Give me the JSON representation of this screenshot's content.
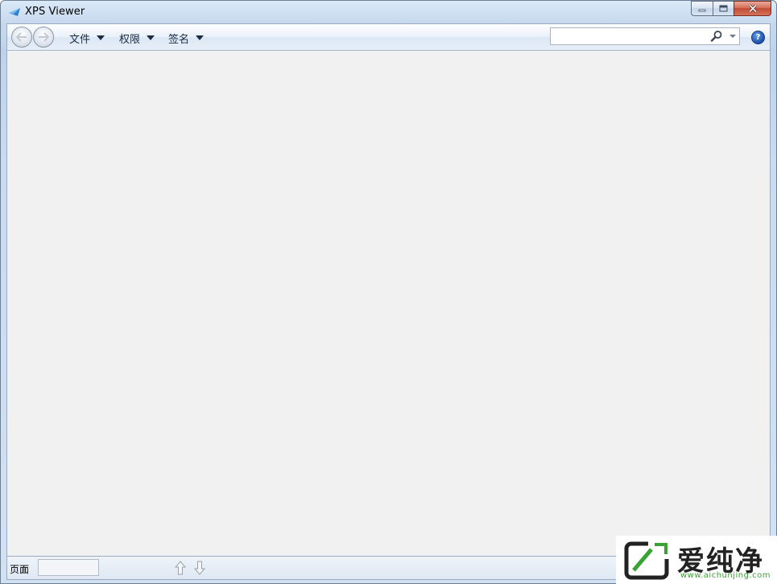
{
  "window": {
    "title": "XPS Viewer",
    "icon": "xps-viewer-app-icon"
  },
  "caption_buttons": {
    "minimize_icon": "minimize-icon",
    "maximize_icon": "maximize-icon",
    "close_icon": "close-icon"
  },
  "toolbar": {
    "back_icon": "back-arrow-icon",
    "forward_icon": "forward-arrow-icon",
    "menus": [
      {
        "label": "文件"
      },
      {
        "label": "权限"
      },
      {
        "label": "签名"
      }
    ],
    "search": {
      "value": "",
      "placeholder": ""
    },
    "help_icon": "help-icon"
  },
  "statusbar": {
    "page_label": "页面",
    "page_value": "",
    "page_up_icon": "page-up-arrow-icon",
    "page_down_icon": "page-down-arrow-icon"
  },
  "watermark": {
    "text": "爱纯净",
    "url": "www.aichunjing.com"
  },
  "colors": {
    "frame": "#c7d9ee",
    "document_background": "#f1f1f1",
    "close_button": "#c24a34",
    "watermark_green": "#3aa335"
  }
}
